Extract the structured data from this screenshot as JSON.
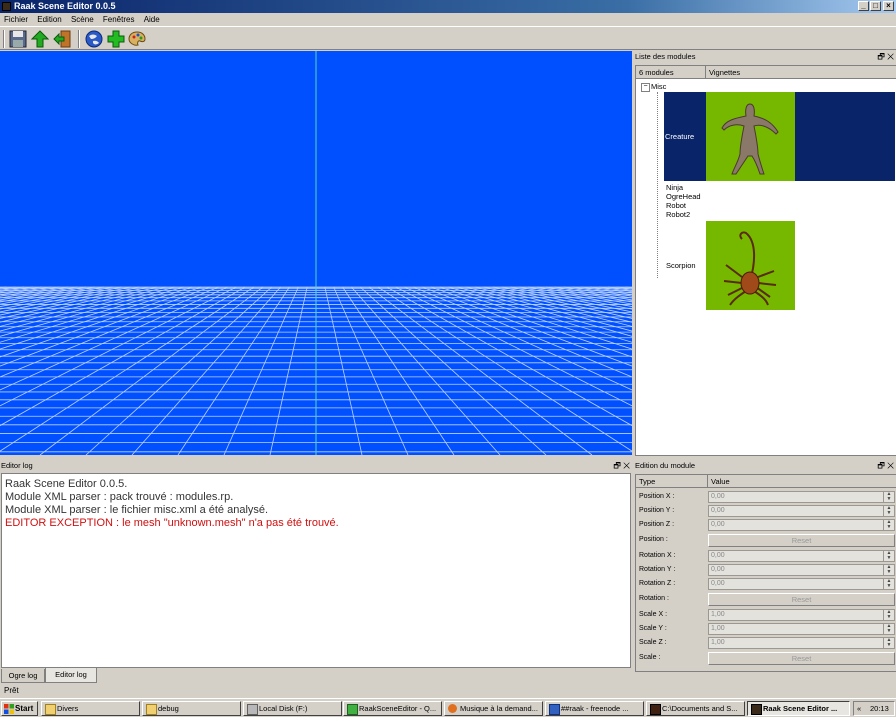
{
  "window": {
    "title": "Raak Scene Editor 0.0.5",
    "min": "_",
    "max": "□",
    "close": "×"
  },
  "menu": {
    "items": [
      "Fichier",
      "Edition",
      "Scène",
      "Fenêtres",
      "Aide"
    ]
  },
  "toolbar": {
    "icons": [
      "save-icon",
      "up-arrow-icon",
      "exit-icon",
      "globe-icon",
      "add-icon",
      "palette-icon"
    ]
  },
  "modules_panel": {
    "title": "Liste des modules",
    "columns": [
      "6 modules",
      "Vignettes"
    ],
    "group": "Misc",
    "group_toggle": "−",
    "items": [
      "Creature",
      "Ninja",
      "OgreHead",
      "Robot",
      "Robot2",
      "Scorpion"
    ]
  },
  "log_panel": {
    "title": "Editor log",
    "lines": [
      "Raak Scene Editor 0.0.5.",
      "Module XML parser : pack trouvé : modules.rp.",
      "Module XML parser : le fichier misc.xml a été analysé."
    ],
    "error_line": "EDITOR EXCEPTION : le mesh \"unknown.mesh\" n'a pas été trouvé.",
    "tabs": [
      "Ogre log",
      "Editor log"
    ]
  },
  "edit_panel": {
    "title": "Edition du module",
    "columns": [
      "Type",
      "Value"
    ],
    "position": {
      "x_label": "Position X :",
      "y_label": "Position Y :",
      "z_label": "Position Z :",
      "label": "Position :",
      "x": "0,00",
      "y": "0,00",
      "z": "0,00"
    },
    "rotation": {
      "x_label": "Rotation X :",
      "y_label": "Rotation Y :",
      "z_label": "Rotation Z :",
      "label": "Rotation :",
      "x": "0,00",
      "y": "0,00",
      "z": "0,00"
    },
    "scale": {
      "x_label": "Scale X :",
      "y_label": "Scale Y :",
      "z_label": "Scale Z :",
      "label": "Scale :",
      "x": "1,00",
      "y": "1,00",
      "z": "1,00"
    },
    "reset_label": "Reset"
  },
  "panel_buttons": "🗗 ✕",
  "status": "Prêt",
  "taskbar": {
    "start": "Start",
    "tasks": [
      "Divers",
      "debug",
      "Local Disk (F:)",
      "RaakSceneEditor - Q...",
      "Musique à la demand...",
      "##raak - freenode ...",
      "C:\\Documents and S...",
      "Raak Scene Editor ..."
    ],
    "tray_arrows": "«",
    "clock": "20:13"
  },
  "colors": {
    "viewport": "#0050ff",
    "thumb_bg": "#76b800",
    "selection": "#0a246a",
    "error": "#d01010"
  }
}
